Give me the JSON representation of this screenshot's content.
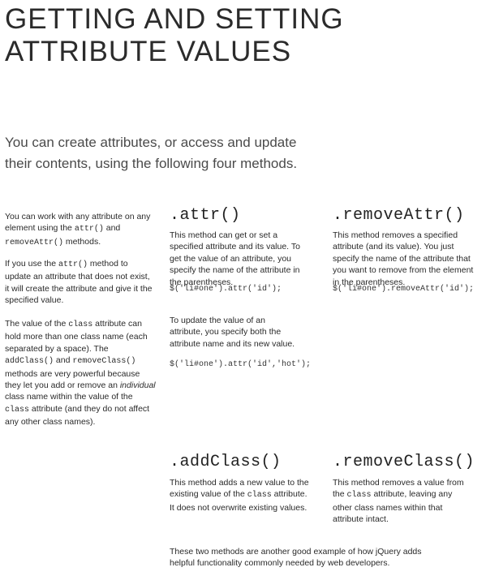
{
  "title": {
    "line1": "GETTING AND SETTING",
    "line2": "ATTRIBUTE VALUES"
  },
  "intro": {
    "line1": "You can create attributes, or access and update",
    "line2": "their contents, using the following four methods."
  },
  "sidebar": {
    "p1": {
      "t1": "You can work with any attribute on any element using the ",
      "c1": "attr()",
      "t2": " and ",
      "c2": "removeAttr()",
      "t3": " methods."
    },
    "p2": {
      "t1": "If you use the ",
      "c1": "attr()",
      "t2": " method to update an attribute that does not exist, it will create the attribute and give it the specified value."
    },
    "p3": {
      "t1": "The value of the ",
      "c1": "class",
      "t2": " attribute can hold more than one class name (each separated by a space). The ",
      "c2": "addClass()",
      "t3": " and ",
      "c3": "removeClass()",
      "t4": " methods are very powerful because they let you add or remove an ",
      "em": "individual",
      "t5": " class name within the value of the ",
      "c4": "class",
      "t6": " attribute (and they do not affect any other class names)."
    }
  },
  "attr": {
    "heading": ".attr()",
    "desc": "This method can get or set a specified attribute and its value. To get the value of an attribute, you specify the name of the attribute in the parentheses.",
    "code1": "$('li#one').attr('id');",
    "desc2": "To update the value of an attribute, you specify both the attribute name and its new value.",
    "code2": "$('li#one').attr('id','hot');"
  },
  "removeAttr": {
    "heading": ".removeAttr()",
    "desc": "This method removes a specified attribute (and its value). You just specify the name of the attribute that you want to remove from the element in the parentheses.",
    "code": "$('li#one').removeAttr('id');"
  },
  "addClass": {
    "heading": ".addClass()",
    "t1": "This method adds a new value to the existing value of the ",
    "c1": "class",
    "t2": " attribute. It does not overwrite existing values."
  },
  "removeClass": {
    "heading": ".removeClass()",
    "t1": "This method removes a value from the ",
    "c1": "class",
    "t2": " attribute, leaving any other class names within that attribute intact."
  },
  "footer": {
    "line1": "These two methods are another good example of how jQuery adds",
    "line2": "helpful functionality commonly needed by web developers."
  }
}
